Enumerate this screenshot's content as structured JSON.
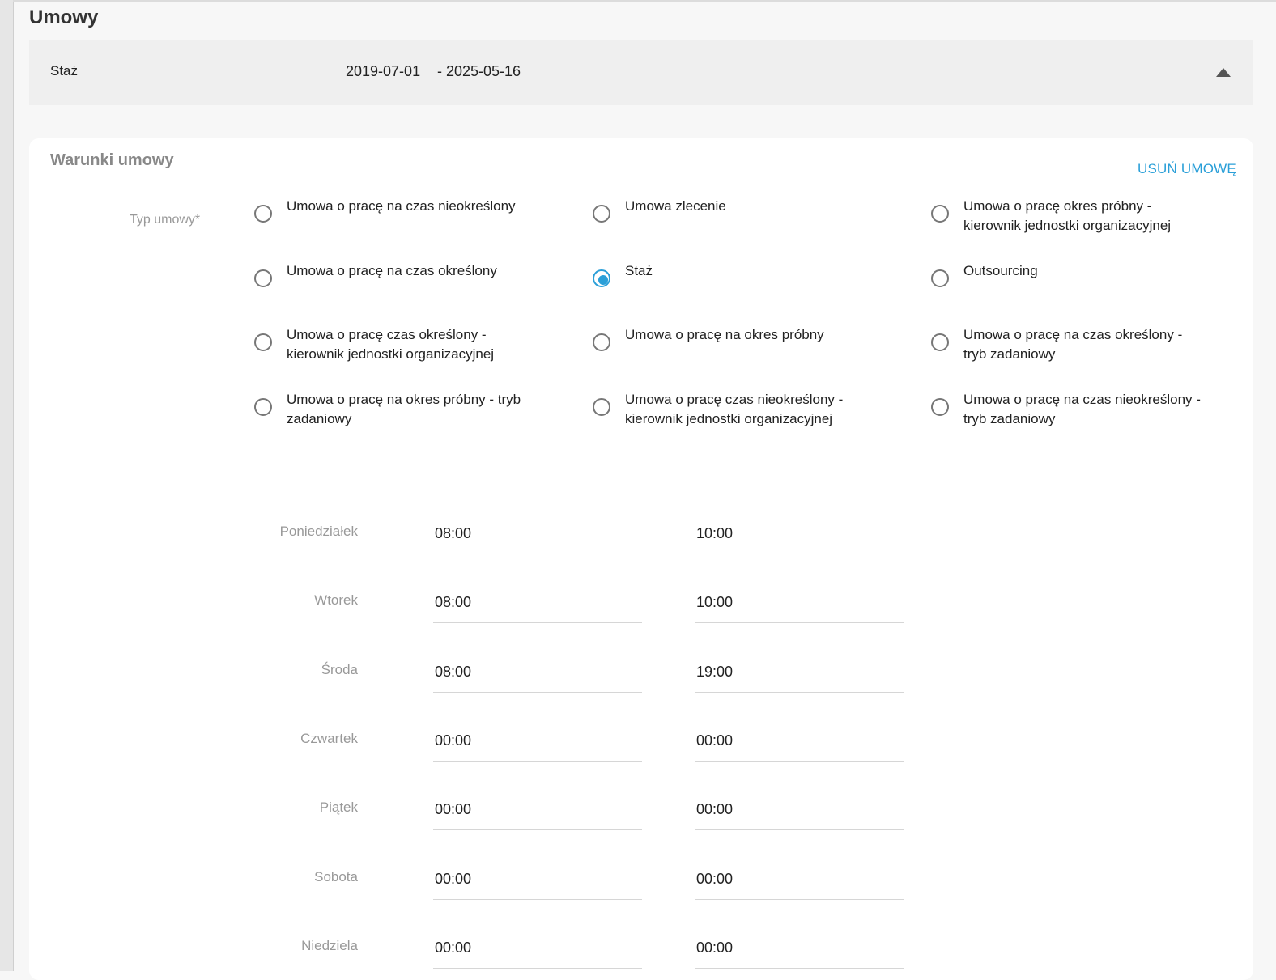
{
  "page": {
    "title": "Umowy"
  },
  "contract_summary": {
    "type": "Staż",
    "date_from": "2019-07-01",
    "date_to": "- 2025-05-16",
    "collapse_icon": "triangle-up-icon"
  },
  "terms": {
    "section_title": "Warunki umowy",
    "delete_label": "USUŃ UMOWĘ",
    "type_label": "Typ umowy*",
    "accent_color": "#2a9fd8",
    "selected_option": "Staż",
    "options": [
      "Umowa o pracę na czas nieokreślony",
      "Umowa zlecenie",
      "Umowa o pracę okres próbny - kierownik jednostki organizacyjnej",
      "Umowa o pracę na czas określony",
      "Staż",
      "Outsourcing",
      "Umowa o pracę czas określony - kierownik jednostki organizacyjnej",
      "Umowa o pracę na okres próbny",
      "Umowa o pracę na czas określony - tryb zadaniowy",
      "Umowa o pracę na okres próbny - tryb zadaniowy",
      "Umowa o pracę czas nieokreślony - kierownik jednostki organizacyjnej",
      "Umowa o pracę na czas nieokreślony - tryb zadaniowy"
    ]
  },
  "schedule": [
    {
      "day": "Poniedziałek",
      "from": "08:00",
      "to": "10:00"
    },
    {
      "day": "Wtorek",
      "from": "08:00",
      "to": "10:00"
    },
    {
      "day": "Środa",
      "from": "08:00",
      "to": "19:00"
    },
    {
      "day": "Czwartek",
      "from": "00:00",
      "to": "00:00"
    },
    {
      "day": "Piątek",
      "from": "00:00",
      "to": "00:00"
    },
    {
      "day": "Sobota",
      "from": "00:00",
      "to": "00:00"
    },
    {
      "day": "Niedziela",
      "from": "00:00",
      "to": "00:00"
    }
  ]
}
